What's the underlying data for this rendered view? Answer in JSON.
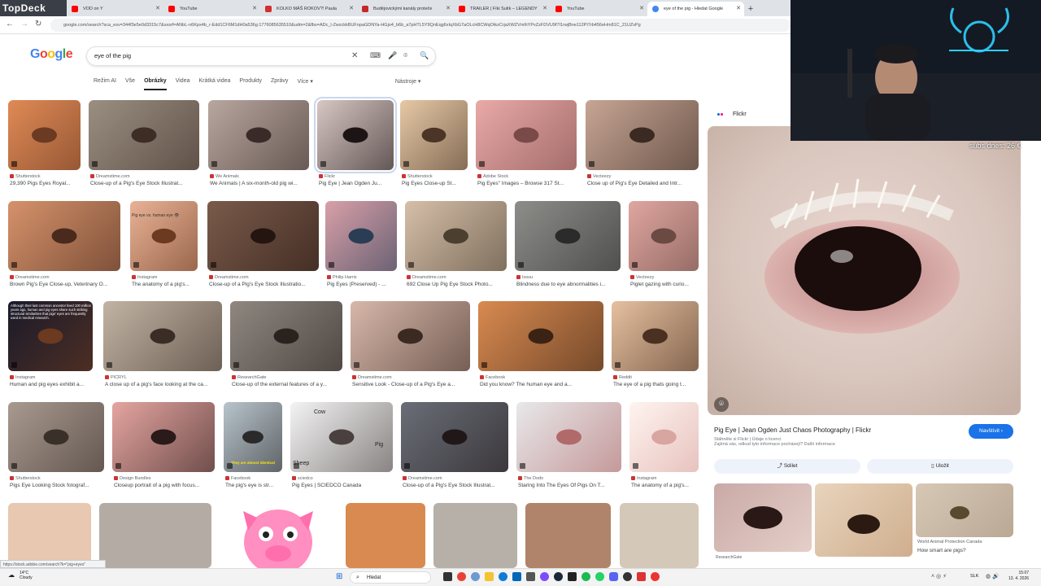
{
  "browser": {
    "tabs": [
      {
        "title": "VOD on Y",
        "color": "#ff0000"
      },
      {
        "title": "YouTube",
        "color": "#ff0000"
      },
      {
        "title": "KOLKO MÁŠ ROKOV?! Paula",
        "color": "#d32f2f"
      },
      {
        "title": "Budějovickými kanály proteče",
        "color": "#c62828"
      },
      {
        "title": "TRAILER | Fíki Sulík – LEGENDY",
        "color": "#ff0000"
      },
      {
        "title": "YouTube",
        "color": "#ff0000"
      },
      {
        "title": "eye of the pig - Hledat Google",
        "color": "#4285f4",
        "active": true
      }
    ],
    "new_tab": "+",
    "stream_logo": "TopDeck",
    "url": "google.com/search?sca_esv=344f3e5e0d3315c7&sxsrf=ANbL-n6Kpx4b_r-Edd1CF6M1dH0a536g:1776085635510&udm=2&fbs=ADc_l-ZwzckkBUFopaGDNYa-HGjo4_b6b_a7pHTL5Y9QnEqg6xIqXbG7aOLcH8CWqOtkzCrjaXWZVmlhYPvZzFDVU9f7I1rwjBne112PI7rb456eHm81C_21UZvPg"
  },
  "google": {
    "logo": [
      "G",
      "o",
      "o",
      "g",
      "l",
      "e"
    ],
    "query": "eye of the pig",
    "filters": [
      "Režim AI",
      "Vše",
      "Obrázky",
      "Videa",
      "Krátká videa",
      "Produkty",
      "Zprávy",
      "Více ▾"
    ],
    "active_filter": "Obrázky",
    "tools": "Nástroje ▾"
  },
  "results": [
    {
      "src": "Shutterstock",
      "title": "29,390 Pigs Eyes Royal..."
    },
    {
      "src": "Dreamstime.com",
      "title": "Close-up of a Pig's Eye Stock Illustrat..."
    },
    {
      "src": "We Animals",
      "title": "We Animals | A six-month-old pig wi..."
    },
    {
      "src": "Flickr",
      "title": "Pig Eye | Jean Ogden Ju..."
    },
    {
      "src": "Shutterstock",
      "title": "Pig Eyes Close-up St..."
    },
    {
      "src": "Adobe Stock",
      "title": "Pig Eyes\" Images – Browse 317 St..."
    },
    {
      "src": "Vecteezy",
      "title": "Close up of Pig's Eye Detailed and Intr..."
    },
    {
      "src": "Dreamstime.com",
      "title": "Brown Pig's Eye Close-up, Veterinary O..."
    },
    {
      "src": "Instagram",
      "title": "The anatomy of a pig's..."
    },
    {
      "src": "Dreamstime.com",
      "title": "Close-up of a Pig's Eye Stock Illustratio..."
    },
    {
      "src": "Philip Harris",
      "title": "Pig Eyes (Preserved) - ..."
    },
    {
      "src": "Dreamstime.com",
      "title": "692 Close Up Pig Eye Stock Photo..."
    },
    {
      "src": "Issuu",
      "title": "Blindness due to eye abnormalities i..."
    },
    {
      "src": "Vecteezy",
      "title": "Piglet gazing with curio..."
    },
    {
      "src": "Instagram",
      "title": "Human and pig eyes exhibit a..."
    },
    {
      "src": "PICRYL",
      "title": "A close up of a pig's face looking at the ca..."
    },
    {
      "src": "ResearchGate",
      "title": "Close-up of the external features of a y..."
    },
    {
      "src": "Dreamstime.com",
      "title": "Sensitive Look - Close-up of a Pig's Eye a..."
    },
    {
      "src": "Facebook",
      "title": "Did you know? The human eye and a..."
    },
    {
      "src": "Reddit",
      "title": "The eye of a pig thats going t..."
    },
    {
      "src": "Shutterstock",
      "title": "Pigs Eye Looking Stock fotograf..."
    },
    {
      "src": "Design Bundles",
      "title": "Closeup portrait of a pig with focus..."
    },
    {
      "src": "Facebook",
      "title": "The pig's eye is str..."
    },
    {
      "src": "sciedco",
      "title": "Pig Eyes | SCIEDCO Canada"
    },
    {
      "src": "Dreamstime.com",
      "title": "Close-up of a Pig's Eye Stock Illustrat..."
    },
    {
      "src": "The Dodo",
      "title": "Staring Into The Eyes Of Pigs On T..."
    },
    {
      "src": "Instagram",
      "title": "The anatomy of a pig's..."
    }
  ],
  "image_text": {
    "pig_vs_human": "Pig eye vs. human eye 👁",
    "cow": "Cow",
    "pig": "Pig",
    "sheep": "Sheep",
    "ig_text": "Although their last common ancestor lived 100 million years ago, human and pig eyes share such striking structural similarities that pigs' eyes are frequently used in medical research.",
    "fb_text": "They are almost identical"
  },
  "panel": {
    "source": "Flickr",
    "title": "Pig Eye | Jean Ogden Just Chaos Photography | Flickr",
    "sub": "Stáhněte si Flickr | Údaje o licenci",
    "sub2": "Zajímá vás, odkud tyto informace pocházejí? Další informace",
    "visit": "Navštívit ›",
    "share": "Sdílet",
    "save": "Uložit",
    "related_src1": "ResearchGate",
    "related_src2": "World Animal Protection Canada",
    "related_title2": "How smart are pigs?"
  },
  "stream": {
    "subs": "subs dnes: 26 €"
  },
  "status_url": "https://stock.adobe.com/search?k=\"pig+eyes\"",
  "taskbar": {
    "weather_temp": "14°C",
    "weather_desc": "Cloudy",
    "search": "Hledat",
    "lang": "SLK",
    "time": "15:07",
    "date": "13. 4. 2026"
  }
}
